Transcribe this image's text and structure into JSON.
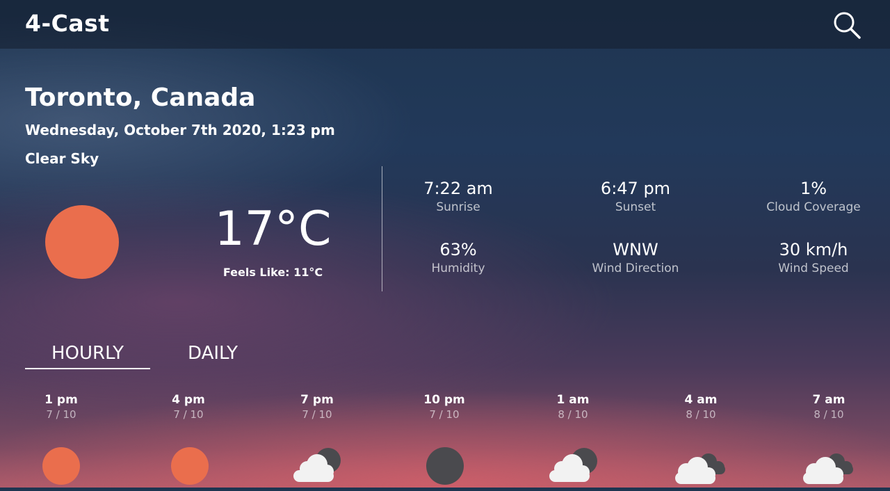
{
  "app": {
    "title": "4-Cast",
    "search_icon": "search-icon"
  },
  "location": {
    "city": "Toronto, Canada",
    "datetime": "Wednesday, October 7th 2020, 1:23 pm",
    "condition": "Clear Sky"
  },
  "current": {
    "temperature": "17°C",
    "feels_like": "Feels Like: 11°C",
    "icon": "sun-icon",
    "icon_color": "#ea6e4d"
  },
  "stats": [
    {
      "value": "7:22 am",
      "label": "Sunrise"
    },
    {
      "value": "6:47 pm",
      "label": "Sunset"
    },
    {
      "value": "1%",
      "label": "Cloud Coverage"
    },
    {
      "value": "63%",
      "label": "Humidity"
    },
    {
      "value": "WNW",
      "label": "Wind Direction"
    },
    {
      "value": "30 km/h",
      "label": "Wind Speed"
    }
  ],
  "tabs": [
    {
      "label": "HOURLY",
      "active": true
    },
    {
      "label": "DAILY",
      "active": false
    }
  ],
  "hourly": [
    {
      "time": "1 pm",
      "date": "7 / 10",
      "icon": "sun-icon"
    },
    {
      "time": "4 pm",
      "date": "7 / 10",
      "icon": "sun-icon"
    },
    {
      "time": "7 pm",
      "date": "7 / 10",
      "icon": "cloud-moon-icon"
    },
    {
      "time": "10 pm",
      "date": "7 / 10",
      "icon": "moon-icon"
    },
    {
      "time": "1 am",
      "date": "8 / 10",
      "icon": "cloud-moon-icon"
    },
    {
      "time": "4 am",
      "date": "8 / 10",
      "icon": "cloudy-icon"
    },
    {
      "time": "7 am",
      "date": "8 / 10",
      "icon": "cloudy-icon"
    }
  ],
  "colors": {
    "sun": "#ea6e4d",
    "moon": "#4a4a4e",
    "cloud": "#f2f2f2"
  }
}
